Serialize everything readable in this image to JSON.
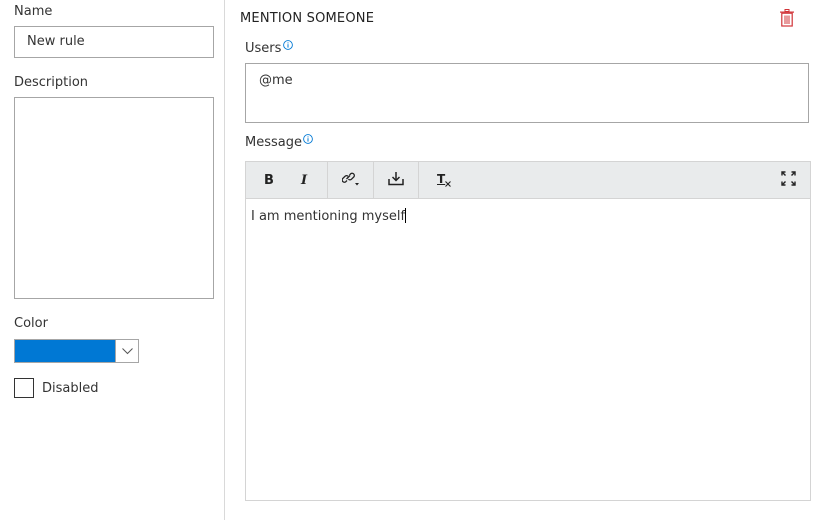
{
  "form": {
    "name_label": "Name",
    "name_value": "New rule",
    "description_label": "Description",
    "description_value": "",
    "color_label": "Color",
    "color_value": "#0078d4",
    "disabled_label": "Disabled",
    "disabled_checked": false
  },
  "action": {
    "title": "MENTION SOMEONE",
    "users_label": "Users",
    "users_value": "@me",
    "message_label": "Message",
    "message_value": "I am mentioning myself"
  },
  "toolbar": {
    "bold_label": "B",
    "italic_label": "I",
    "clear_format_label": "T"
  },
  "colors": {
    "accent": "#0078d4",
    "delete": "#d13438",
    "info": "#0078d4",
    "toolbar_bg": "#e9ebec"
  }
}
